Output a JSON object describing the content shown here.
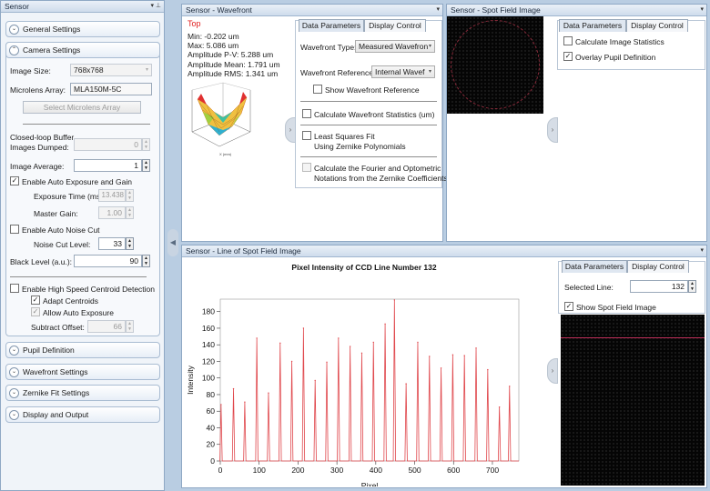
{
  "left_panel": {
    "title": "Sensor",
    "sections": {
      "general": "General Settings",
      "camera": "Camera Settings",
      "pupil": "Pupil Definition",
      "wavefront": "Wavefront Settings",
      "zernike": "Zernike Fit Settings",
      "display": "Display and Output"
    },
    "camera": {
      "image_size_label": "Image Size:",
      "image_size_value": "768x768",
      "microlens_label": "Microlens Array:",
      "microlens_value": "MLA150M-5C",
      "select_microlens_button": "Select Microlens Array",
      "closed_loop_label_1": "Closed-loop Buffer",
      "closed_loop_label_2": "Images Dumped:",
      "closed_loop_value": "0",
      "image_average_label": "Image Average:",
      "image_average_value": "1",
      "auto_exposure_label": "Enable Auto Exposure and Gain",
      "auto_exposure_checked": true,
      "exposure_time_label": "Exposure Time (ms):",
      "exposure_time_value": "13.438",
      "master_gain_label": "Master Gain:",
      "master_gain_value": "1.00",
      "auto_noise_label": "Enable Auto Noise Cut",
      "auto_noise_checked": false,
      "noise_cut_label": "Noise Cut Level:",
      "noise_cut_value": "33",
      "black_level_label": "Black Level (a.u.):",
      "black_level_value": "90",
      "high_speed_label": "Enable High Speed Centroid Detection",
      "high_speed_checked": false,
      "adapt_centroids_label": "Adapt Centroids",
      "adapt_centroids_checked": true,
      "allow_auto_exposure_label": "Allow Auto Exposure",
      "allow_auto_exposure_checked": true,
      "subtract_offset_label": "Subtract Offset:",
      "subtract_offset_value": "66"
    }
  },
  "wavefront_panel": {
    "title": "Sensor - Wavefront",
    "view_label": "Top",
    "stats": {
      "min": "Min: -0.202 um",
      "max": "Max: 5.086 um",
      "pv": "Amplitude P-V: 5.288 um",
      "mean": "Amplitude Mean: 1.791 um",
      "rms": "Amplitude RMS: 1.341 um"
    },
    "tabs": [
      "Data Parameters",
      "Display Control"
    ],
    "wavefront_type_label": "Wavefront Type:",
    "wavefront_type_value": "Measured Wavefron",
    "wavefront_reference_label": "Wavefront Reference:",
    "wavefront_reference_value": "Internal Wavef",
    "show_reference_label": "Show Wavefront Reference",
    "calc_stats_label": "Calculate Wavefront Statistics (um)",
    "least_squares_label_1": "Least Squares Fit",
    "least_squares_label_2": "Using Zernike Polynomials",
    "fourier_label_1": "Calculate the Fourier and Optometric",
    "fourier_label_2": "Notations from the Zernike Coefficients"
  },
  "spot_panel": {
    "title": "Sensor - Spot Field Image",
    "tabs": [
      "Data Parameters",
      "Display Control"
    ],
    "calc_stats_label": "Calculate Image Statistics",
    "calc_stats_checked": false,
    "overlay_label": "Overlay Pupil Definition",
    "overlay_checked": true
  },
  "line_panel": {
    "title": "Sensor - Line of Spot Field Image",
    "tabs": [
      "Data Parameters",
      "Display Control"
    ],
    "selected_line_label": "Selected Line:",
    "selected_line_value": "132",
    "show_spot_label": "Show Spot Field Image",
    "show_spot_checked": true
  },
  "colors": {
    "line_series": "#e0474c",
    "panel_border": "#8fa8c4",
    "title_bg": "#cfdcec"
  },
  "chart_data": {
    "type": "line",
    "title": "Pixel Intensity of CCD Line Number 132",
    "xlabel": "Pixel",
    "ylabel": "Intensity",
    "xlim": [
      0,
      768
    ],
    "ylim": [
      0,
      195
    ],
    "xticks": [
      0,
      100,
      200,
      300,
      400,
      500,
      600,
      700
    ],
    "yticks": [
      0,
      20,
      40,
      60,
      80,
      100,
      120,
      140,
      160,
      180
    ],
    "series": [
      {
        "peaks": [
          {
            "x": 2,
            "y": 68
          },
          {
            "x": 34,
            "y": 87
          },
          {
            "x": 63,
            "y": 71
          },
          {
            "x": 94,
            "y": 148
          },
          {
            "x": 124,
            "y": 82
          },
          {
            "x": 154,
            "y": 142
          },
          {
            "x": 184,
            "y": 120
          },
          {
            "x": 214,
            "y": 160
          },
          {
            "x": 244,
            "y": 97
          },
          {
            "x": 274,
            "y": 119
          },
          {
            "x": 304,
            "y": 148
          },
          {
            "x": 334,
            "y": 138
          },
          {
            "x": 364,
            "y": 130
          },
          {
            "x": 394,
            "y": 143
          },
          {
            "x": 424,
            "y": 165
          },
          {
            "x": 448,
            "y": 194
          },
          {
            "x": 478,
            "y": 93
          },
          {
            "x": 508,
            "y": 143
          },
          {
            "x": 538,
            "y": 126
          },
          {
            "x": 568,
            "y": 112
          },
          {
            "x": 598,
            "y": 128
          },
          {
            "x": 628,
            "y": 127
          },
          {
            "x": 658,
            "y": 136
          },
          {
            "x": 688,
            "y": 110
          },
          {
            "x": 718,
            "y": 65
          },
          {
            "x": 744,
            "y": 90
          }
        ]
      }
    ]
  }
}
